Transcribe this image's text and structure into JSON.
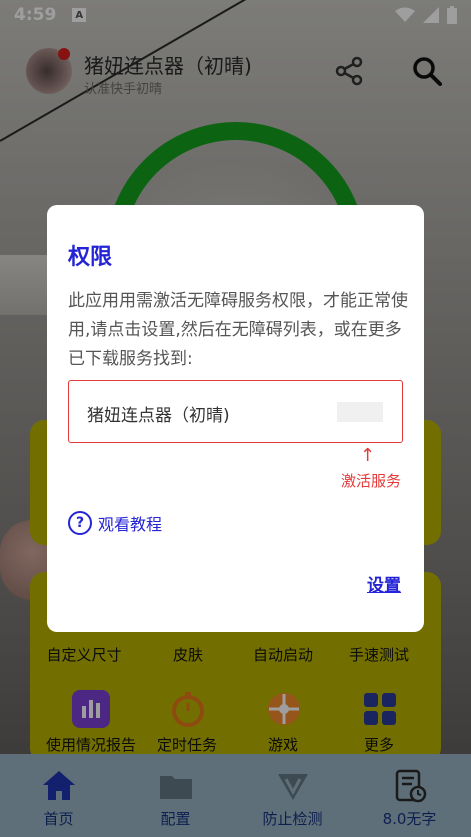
{
  "status_bar": {
    "time": "4:59",
    "a_icon_text": "A"
  },
  "header": {
    "title": "猪妞连点器（初晴)",
    "subtitle": "认准快手初晴"
  },
  "grid": {
    "row1": [
      "自定义尺寸",
      "皮肤",
      "自动启动",
      "手速测试"
    ],
    "row2": [
      "使用情况报告",
      "定时任务",
      "游戏",
      "更多"
    ]
  },
  "bottom_nav": {
    "items": [
      {
        "label": "首页",
        "icon": "home-icon"
      },
      {
        "label": "配置",
        "icon": "folder-icon"
      },
      {
        "label": "防止检测",
        "icon": "v-shield-icon"
      },
      {
        "label": "8.0无字",
        "icon": "document-clock-icon"
      }
    ]
  },
  "dialog": {
    "title": "权限",
    "message": "此应用用需激活无障碍服务权限，才能正常使用,请点击设置,然后在无障碍列表，或在更多已下载服务找到:",
    "service_name": "猪妞连点器（初晴)",
    "arrow": "↑",
    "activate_label": "激活服务",
    "tutorial_label": "观看教程",
    "help_symbol": "?",
    "settings_label": "设置"
  },
  "colors": {
    "accent_blue": "#2424d6",
    "alert_red": "#e43a3a",
    "green_ring": "#14a01e",
    "yellow_card": "#b8b400"
  }
}
